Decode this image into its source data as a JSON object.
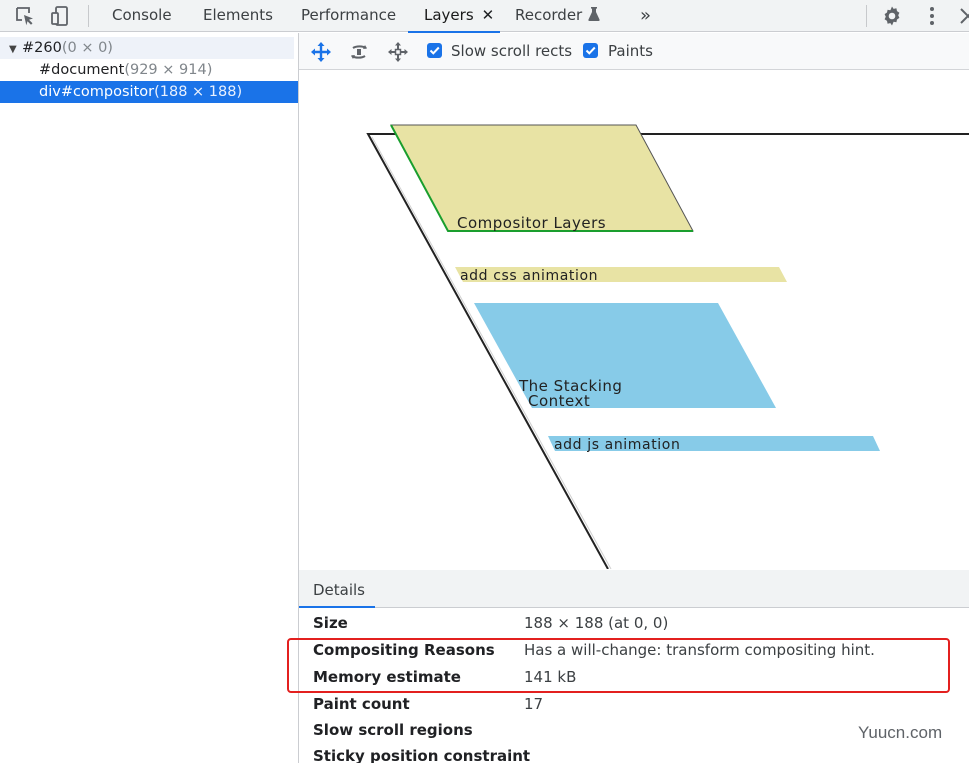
{
  "tabbar": {
    "tabs": [
      {
        "label": "Console"
      },
      {
        "label": "Elements"
      },
      {
        "label": "Performance"
      },
      {
        "label": "Layers",
        "active": true
      },
      {
        "label": "Recorder"
      }
    ],
    "close_glyph": "✕",
    "more_glyph": "»",
    "icons": [
      "inspect-element-icon",
      "device-toggle-icon",
      "flask-icon",
      "settings-gear-icon",
      "kebab-menu-icon",
      "close-devtools-icon"
    ]
  },
  "tree": {
    "rows": [
      {
        "name": "#260",
        "dims": "(0 × 0)"
      },
      {
        "name": "#document",
        "dims": "(929 × 914)"
      },
      {
        "name": "div#compositor",
        "dims": "(188 × 188)"
      }
    ]
  },
  "layers_toolbar": {
    "icons": [
      "pan-mode-icon",
      "rotate-mode-icon",
      "reset-transform-icon"
    ],
    "slow_scroll_rects": {
      "label": "Slow scroll rects",
      "checked": true
    },
    "paints": {
      "label": "Paints",
      "checked": true
    }
  },
  "viewport": {
    "layers": [
      {
        "label": "Compositor Layers",
        "color": "#e8e3a4"
      },
      {
        "label": "add css animation",
        "color": "#e8e3a4"
      },
      {
        "label_line1": "The Stacking",
        "label_line2": "Context",
        "color": "#87cbe8"
      },
      {
        "label": "add js animation",
        "color": "#87cbe8"
      }
    ]
  },
  "details": {
    "tab_label": "Details",
    "rows": [
      {
        "key": "Size",
        "value": "188 × 188 (at 0, 0)"
      },
      {
        "key": "Compositing Reasons",
        "value": "Has a will-change: transform compositing hint."
      },
      {
        "key": "Memory estimate",
        "value": "141 kB"
      },
      {
        "key": "Paint count",
        "value": "17"
      },
      {
        "key": "Slow scroll regions",
        "value": ""
      },
      {
        "key": "Sticky position constraint",
        "value": ""
      }
    ]
  },
  "watermark": "Yuucn.com",
  "colors": {
    "accent": "#1a73e8",
    "highlight": "#e3201f",
    "yellow_layer": "#e8e3a4",
    "blue_layer": "#87cbe8"
  }
}
